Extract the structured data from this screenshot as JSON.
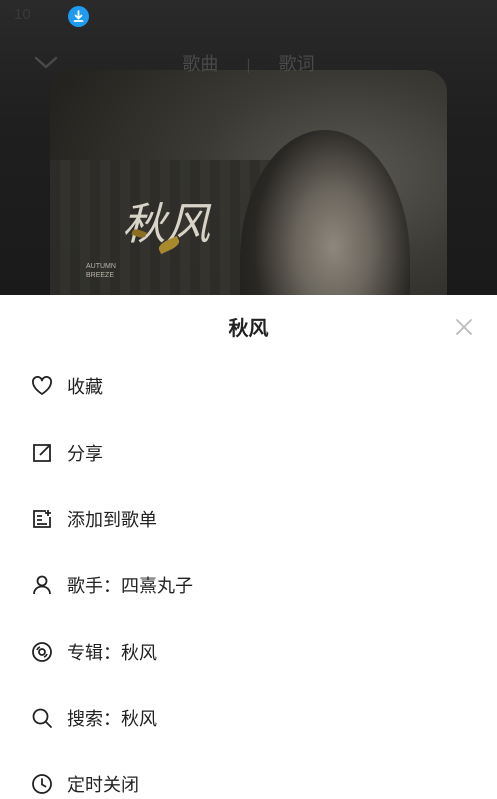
{
  "status_bar": {
    "time": "10",
    "right": ""
  },
  "player": {
    "tabs": [
      "歌曲",
      "歌词"
    ],
    "tab_separator": "|",
    "cover": {
      "title": "秋风",
      "subtitle": "AUTUMN\nBREEZE"
    }
  },
  "sheet": {
    "title": "秋风",
    "items": [
      {
        "label": "收藏",
        "icon": "heart-icon"
      },
      {
        "label": "分享",
        "icon": "share-icon"
      },
      {
        "label": "添加到歌单",
        "icon": "add-to-playlist-icon"
      },
      {
        "label": "歌手：四熹丸子",
        "icon": "person-icon"
      },
      {
        "label": "专辑：秋风",
        "icon": "disc-icon"
      },
      {
        "label": "搜索：秋风",
        "icon": "search-icon"
      },
      {
        "label": "定时关闭",
        "icon": "clock-icon"
      }
    ]
  },
  "colors": {
    "accent": "#1e9bf0",
    "sheet_bg": "#ffffff",
    "text": "#222222"
  }
}
